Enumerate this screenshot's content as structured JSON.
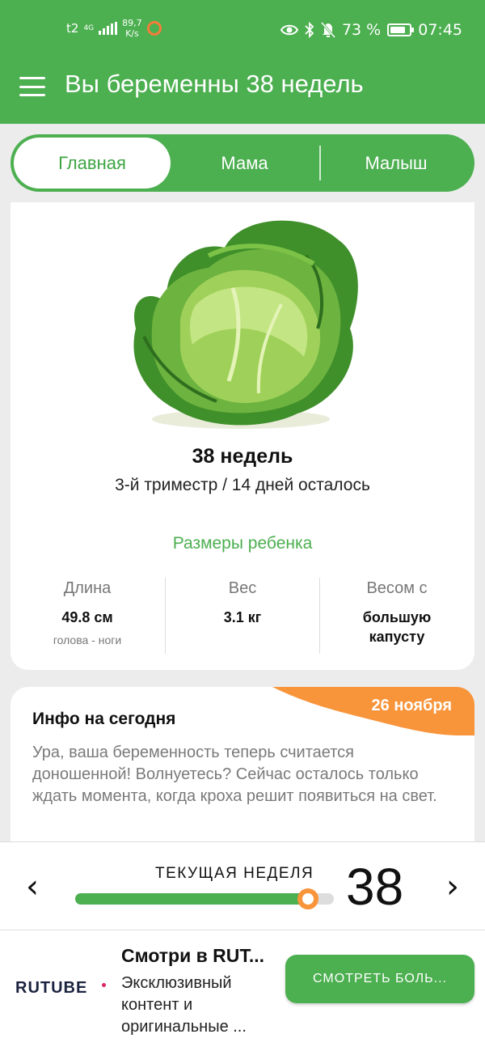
{
  "status_bar": {
    "carrier": "t2",
    "network": "4G",
    "speed_value": "89,7",
    "speed_unit": "K/s",
    "battery": "73 %",
    "time": "07:45"
  },
  "header": {
    "title": "Вы беременны 38 недель",
    "menu_icon": "hamburger-menu-icon"
  },
  "tabs": [
    {
      "label": "Главная",
      "active": true
    },
    {
      "label": "Мама",
      "active": false
    },
    {
      "label": "Малыш",
      "active": false
    }
  ],
  "overview": {
    "image": "cabbage",
    "weeks": "38 недель",
    "trimester": "3-й триместр / 14 дней осталось",
    "sizes_title": "Размеры ребенка",
    "length": {
      "label": "Длина",
      "value": "49.8 см",
      "note": "голова - ноги"
    },
    "weight": {
      "label": "Вес",
      "value": "3.1 кг"
    },
    "compare": {
      "label": "Весом с",
      "value": "большую капусту"
    }
  },
  "info": {
    "date": "26 ноября",
    "title": "Инфо на сегодня",
    "text": "Ура, ваша беременность теперь считается доношенной! Волнуетесь? Сейчас осталось только ждать момента, когда кроха решит появиться на свет."
  },
  "week_selector": {
    "label": "ТЕКУЩАЯ НЕДЕЛЯ",
    "week": "38",
    "progress_fraction": 0.9,
    "prev_icon": "chevron-left-icon",
    "next_icon": "chevron-right-icon"
  },
  "ad": {
    "brand": "RUTUBE",
    "title": "Смотри в RUT...",
    "text": "Эксклюзивный контент и оригинальные ...",
    "button": "СМОТРЕТЬ БОЛЬ..."
  },
  "colors": {
    "primary": "#4caf50",
    "accent": "#f8943a",
    "background": "#ececec"
  }
}
